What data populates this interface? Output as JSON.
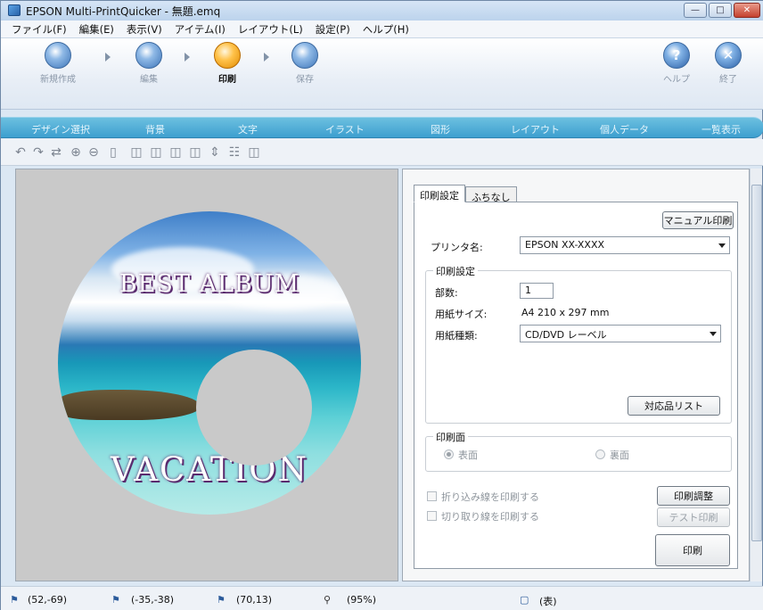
{
  "window": {
    "title": "EPSON Multi-PrintQuicker - 無題.emq"
  },
  "menu": {
    "items": [
      "ファイル(F)",
      "編集(E)",
      "表示(V)",
      "アイテム(I)",
      "レイアウト(L)",
      "設定(P)",
      "ヘルプ(H)"
    ]
  },
  "workflow": {
    "steps": [
      {
        "label": "新規作成",
        "icon": "new-document-icon"
      },
      {
        "label": "編集",
        "icon": "edit-icon"
      },
      {
        "label": "印刷",
        "icon": "print-icon",
        "active": true
      },
      {
        "label": "保存",
        "icon": "save-icon"
      }
    ],
    "help": {
      "label": "ヘルプ",
      "glyph": "?"
    },
    "exit": {
      "label": "終了",
      "glyph": "✕"
    }
  },
  "design_tabs": [
    "デザイン選択",
    "背景",
    "文字",
    "イラスト",
    "図形",
    "レイアウト",
    "個人データ",
    "一覧表示"
  ],
  "disc": {
    "title_top": "BEST ALBUM",
    "title_bottom": "VACATION"
  },
  "panel": {
    "tabs": {
      "print_settings": "印刷設定",
      "bleed": "ふちなし"
    },
    "manual_print_button": "マニュアル印刷",
    "printer_label": "プリンタ名:",
    "printer_value": "EPSON XX-XXXX",
    "print_settings_group": "印刷設定",
    "copies_label": "部数:",
    "copies_value": "1",
    "paper_size_label": "用紙サイズ:",
    "paper_size_value": "A4 210 x 297 mm",
    "paper_type_label": "用紙種類:",
    "paper_type_value": "CD/DVD レーベル",
    "supported_list_button": "対応品リスト",
    "print_side_group": "印刷面",
    "side_front": "表面",
    "side_back": "裏面",
    "fold_line_checkbox": "折り込み線を印刷する",
    "cut_line_checkbox": "切り取り線を印刷する",
    "adjust_button": "印刷調整",
    "test_print_button": "テスト印刷",
    "print_button": "印刷"
  },
  "statusbar": {
    "cursor": "(52,-69)",
    "position": "(-35,-38)",
    "size": "(70,13)",
    "zoom": "(95%)",
    "side": "(表)"
  },
  "colors": {
    "accent": "#3d9fcf",
    "active_step": "#ffc24a",
    "title_text_shadow": "#5a2a6e"
  }
}
